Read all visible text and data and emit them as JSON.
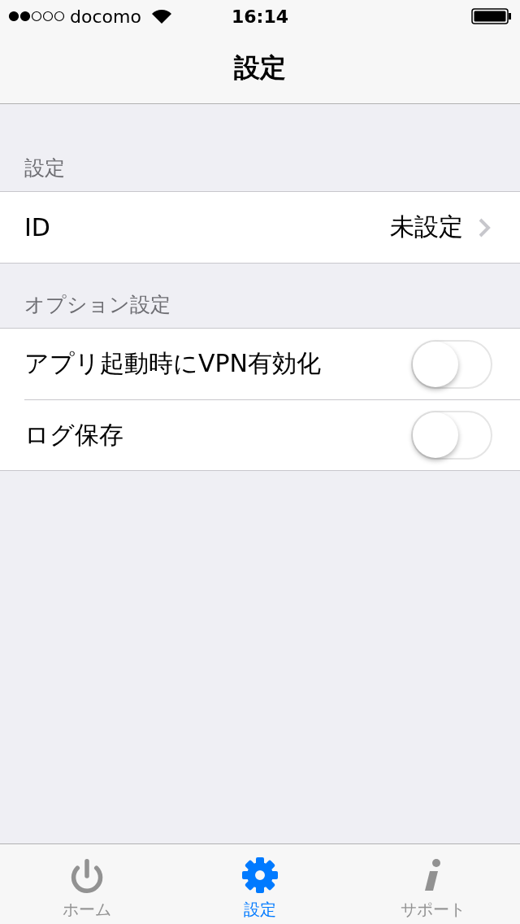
{
  "status_bar": {
    "carrier": "docomo",
    "time": "16:14"
  },
  "nav": {
    "title": "設定"
  },
  "sections": [
    {
      "header": "設定",
      "rows": [
        {
          "kind": "link",
          "label": "ID",
          "value": "未設定"
        }
      ]
    },
    {
      "header": "オプション設定",
      "rows": [
        {
          "kind": "toggle",
          "label": "アプリ起動時にVPN有効化",
          "on": false
        },
        {
          "kind": "toggle",
          "label": "ログ保存",
          "on": false
        }
      ]
    }
  ],
  "tab_bar": [
    {
      "label": "ホーム",
      "kind": "power",
      "selected": false
    },
    {
      "label": "設定",
      "kind": "gear",
      "selected": true
    },
    {
      "label": "サポート",
      "kind": "info",
      "selected": false
    }
  ]
}
